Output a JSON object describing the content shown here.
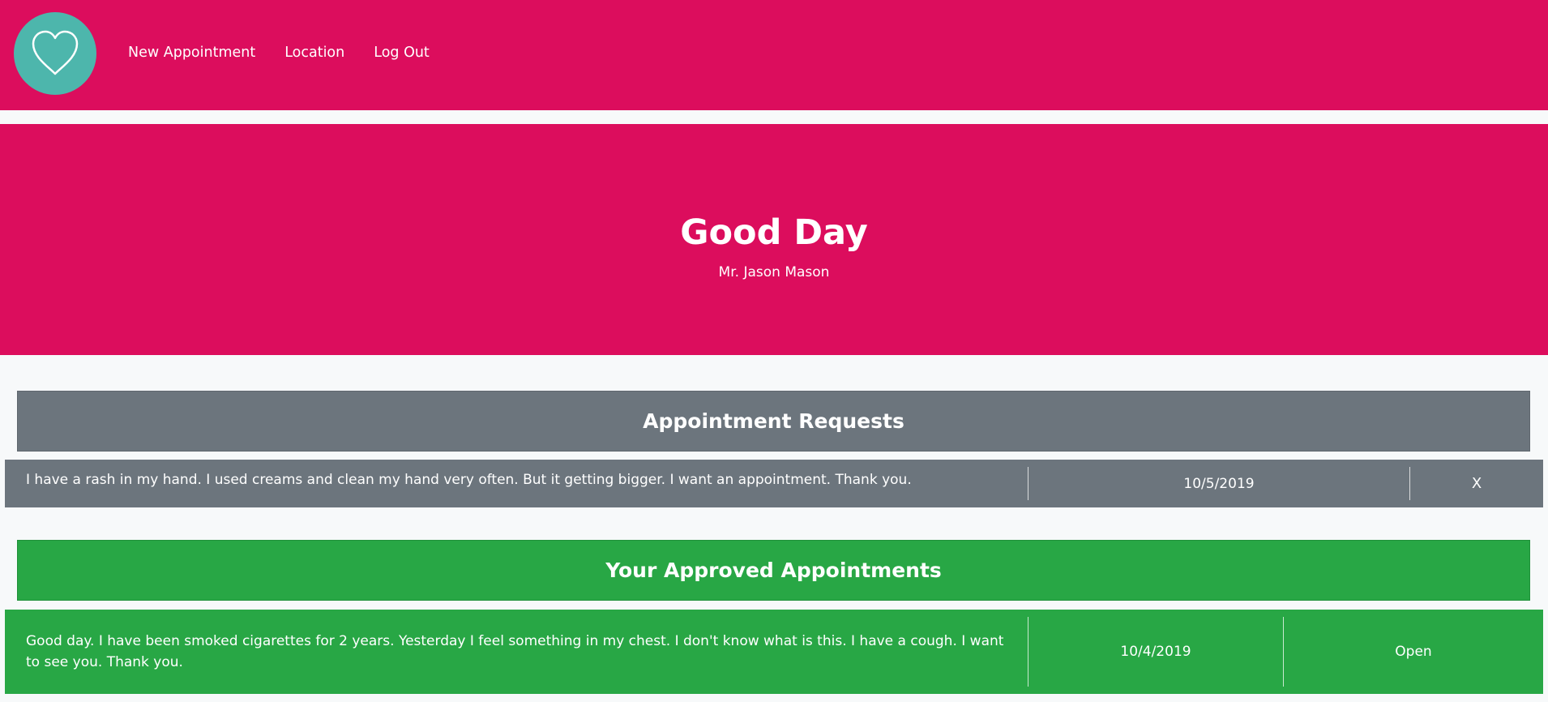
{
  "nav": {
    "logo_icon": "heart-icon",
    "links": [
      "New Appointment",
      "Location",
      "Log Out"
    ]
  },
  "hero": {
    "title": "Good Day",
    "subtitle": "Mr. Jason Mason"
  },
  "requests": {
    "title": "Appointment Requests",
    "items": [
      {
        "message": "I have a rash in my hand. I used creams and clean my hand very often. But it getting bigger. I want an appointment. Thank you.",
        "date": "10/5/2019",
        "action": "X"
      }
    ]
  },
  "approved": {
    "title": "Your Approved Appointments",
    "items": [
      {
        "message": "Good day. I have been smoked cigarettes for 2 years. Yesterday I feel something in my chest. I don't know what is this. I have a cough. I want to see you. Thank you.",
        "date": "10/4/2019",
        "status": "Open"
      }
    ]
  },
  "colors": {
    "primary": "#dc0d5d",
    "logo": "#4db6ac",
    "request": "#6c757d",
    "approved": "#28a745"
  }
}
